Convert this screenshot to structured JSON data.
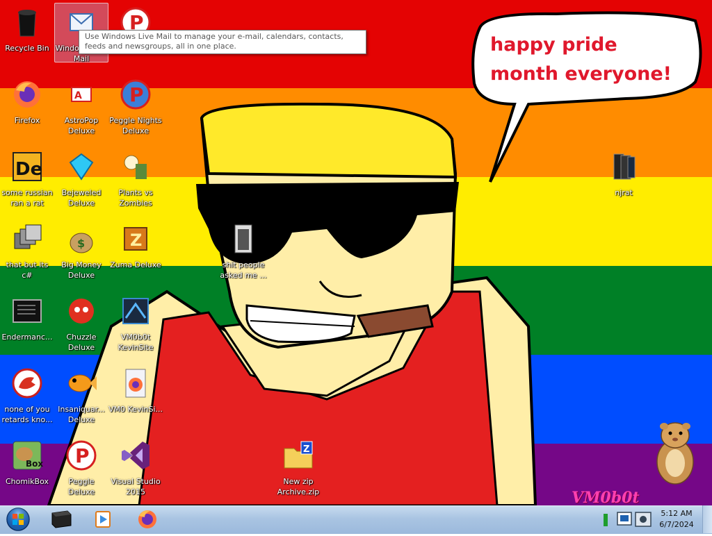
{
  "wallpaper": {
    "stripes": [
      "#e40303",
      "#ff8c00",
      "#ffed00",
      "#008026",
      "#004dff",
      "#750787"
    ],
    "speech_bubble": "happy pride month everyone!"
  },
  "tooltip": {
    "text": "Use Windows Live Mail to manage your e-mail, calendars, contacts, feeds and newsgroups, all in one place."
  },
  "desktop_icons": [
    {
      "label": "Recycle Bin",
      "icon": "recycle-bin-icon"
    },
    {
      "label": "Windows Live Mail",
      "icon": "windows-live-mail-icon",
      "selected": true
    },
    {
      "label": "of Warcraft ...",
      "icon": "peggle-icon"
    },
    {
      "label": "Firefox",
      "icon": "firefox-icon"
    },
    {
      "label": "AstroPop Deluxe",
      "icon": "astropop-icon"
    },
    {
      "label": "Peggle Nights Deluxe",
      "icon": "peggle-nights-icon"
    },
    {
      "label": "some russian ran a rat",
      "icon": "de-icon"
    },
    {
      "label": "Bejeweled Deluxe",
      "icon": "bejeweled-icon"
    },
    {
      "label": "Plants vs Zombies",
      "icon": "plants-vs-zombies-icon"
    },
    {
      "label": "that but its c#",
      "icon": "stacked-windows-icon"
    },
    {
      "label": "Big Money Deluxe",
      "icon": "money-bag-icon"
    },
    {
      "label": "Zuma Deluxe",
      "icon": "zuma-icon"
    },
    {
      "label": "Endermanc...",
      "icon": "terminal-icon"
    },
    {
      "label": "Chuzzle Deluxe",
      "icon": "chuzzle-icon"
    },
    {
      "label": "VM0b0t KevinSite",
      "icon": "vm-icon"
    },
    {
      "label": "none of you retards kno...",
      "icon": "red-dino-icon"
    },
    {
      "label": "Insaniquar... Deluxe",
      "icon": "goldfish-icon"
    },
    {
      "label": "VM0 KevinSi...",
      "icon": "firefox-file-icon"
    },
    {
      "label": "ChomikBox",
      "icon": "chomikbox-icon"
    },
    {
      "label": "Peggle Deluxe",
      "icon": "peggle-deluxe-icon"
    },
    {
      "label": "Visual Studio 2015",
      "icon": "visual-studio-icon"
    },
    {
      "label": "shit people asked me ...",
      "icon": "folder-file-icon"
    },
    {
      "label": "New zip Archive.zip",
      "icon": "zip-folder-icon"
    },
    {
      "label": "njrat",
      "icon": "njrat-icon"
    }
  ],
  "watermark": "VM0b0t",
  "taskbar": {
    "clock_time": "5:12 AM",
    "clock_date": "6/7/2024",
    "pinned": [
      "app-icon",
      "media-player-icon",
      "firefox-icon"
    ]
  }
}
